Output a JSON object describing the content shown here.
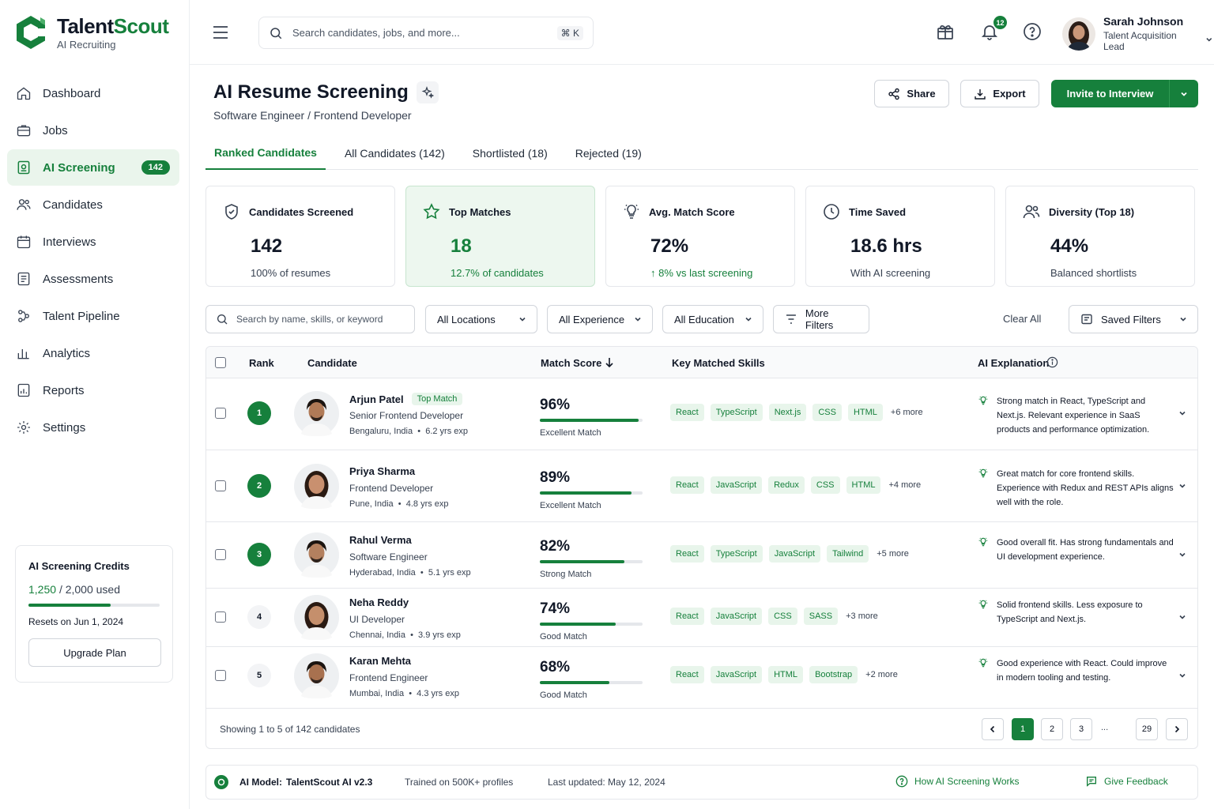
{
  "brand": {
    "name_a": "Talent",
    "name_b": "Scout",
    "sub": "AI Recruiting",
    "accent": "#16803c"
  },
  "nav": [
    {
      "label": "Dashboard",
      "icon": "home-icon"
    },
    {
      "label": "Jobs",
      "icon": "briefcase-icon"
    },
    {
      "label": "AI Screening",
      "icon": "ai-scan-icon",
      "badge": "142",
      "active": true
    },
    {
      "label": "Candidates",
      "icon": "users-icon"
    },
    {
      "label": "Interviews",
      "icon": "calendar-icon"
    },
    {
      "label": "Assessments",
      "icon": "clipboard-icon"
    },
    {
      "label": "Talent Pipeline",
      "icon": "pipeline-icon"
    },
    {
      "label": "Analytics",
      "icon": "bar-chart-icon"
    },
    {
      "label": "Reports",
      "icon": "report-icon"
    },
    {
      "label": "Settings",
      "icon": "gear-icon"
    }
  ],
  "credits": {
    "title": "AI Screening Credits",
    "used": "1,250",
    "total": "/ 2,000 used",
    "fraction": 0.625,
    "reset": "Resets on Jun 1, 2024",
    "upgrade": "Upgrade Plan"
  },
  "topbar": {
    "search_placeholder": "Search candidates, jobs, and more...",
    "shortcut": "⌘ K",
    "notifications": "12"
  },
  "user": {
    "name": "Sarah Johnson",
    "role": "Talent Acquisition Lead"
  },
  "page": {
    "title": "AI Resume Screening",
    "subtitle": "Software Engineer / Frontend Developer",
    "share": "Share",
    "export": "Export",
    "invite": "Invite to Interview"
  },
  "tabs": [
    "Ranked Candidates",
    "All Candidates (142)",
    "Shortlisted (18)",
    "Rejected (19)"
  ],
  "stats": [
    {
      "title": "Candidates Screened",
      "value": "142",
      "sub": "100% of resumes",
      "icon": "shield-icon"
    },
    {
      "title": "Top Matches",
      "value": "18",
      "sub": "12.7% of candidates",
      "icon": "star-icon"
    },
    {
      "title": "Avg. Match Score",
      "value": "72%",
      "sub": "↑ 8% vs last screening",
      "icon": "bulb-icon"
    },
    {
      "title": "Time Saved",
      "value": "18.6 hrs",
      "sub": "With AI screening",
      "icon": "clock-icon"
    },
    {
      "title": "Diversity (Top 18)",
      "value": "44%",
      "sub": "Balanced shortlists",
      "icon": "people-icon"
    }
  ],
  "filters": {
    "search_placeholder": "Search by name, skills, or keyword",
    "locations": "All Locations",
    "experience": "All Experience",
    "education": "All Education",
    "more": "More Filters",
    "clear": "Clear All",
    "saved": "Saved Filters"
  },
  "table": {
    "headers": {
      "rank": "Rank",
      "candidate": "Candidate",
      "score": "Match Score",
      "skills": "Key Matched Skills",
      "explanation": "AI Explanation"
    },
    "rows": [
      {
        "rank": "1",
        "name": "Arjun Patel",
        "badge": "Top Match",
        "title": "Senior Frontend Developer",
        "location": "Bengaluru, India",
        "exp": "6.2 yrs exp",
        "score": "96%",
        "score_value": 0.96,
        "label": "Excellent Match",
        "skills": [
          "React",
          "TypeScript",
          "Next.js",
          "CSS",
          "HTML"
        ],
        "more": "+6 more",
        "explanation": "Strong match in React, TypeScript and Next.js. Relevant experience in SaaS products and performance optimization."
      },
      {
        "rank": "2",
        "name": "Priya Sharma",
        "title": "Frontend Developer",
        "location": "Pune, India",
        "exp": "4.8 yrs exp",
        "score": "89%",
        "score_value": 0.89,
        "label": "Excellent Match",
        "skills": [
          "React",
          "JavaScript",
          "Redux",
          "CSS",
          "HTML"
        ],
        "more": "+4 more",
        "explanation": "Great match for core frontend skills. Experience with Redux and REST APIs aligns well with the role."
      },
      {
        "rank": "3",
        "name": "Rahul Verma",
        "title": "Software Engineer",
        "location": "Hyderabad, India",
        "exp": "5.1 yrs exp",
        "score": "82%",
        "score_value": 0.82,
        "label": "Strong Match",
        "skills": [
          "React",
          "TypeScript",
          "JavaScript",
          "Tailwind"
        ],
        "more": "+5 more",
        "explanation": "Good overall fit. Has strong fundamentals and UI development experience."
      },
      {
        "rank": "4",
        "name": "Neha Reddy",
        "title": "UI Developer",
        "location": "Chennai, India",
        "exp": "3.9 yrs exp",
        "score": "74%",
        "score_value": 0.74,
        "label": "Good Match",
        "skills": [
          "React",
          "JavaScript",
          "CSS",
          "SASS"
        ],
        "more": "+3 more",
        "explanation": "Solid frontend skills. Less exposure to TypeScript and Next.js."
      },
      {
        "rank": "5",
        "name": "Karan Mehta",
        "title": "Frontend Engineer",
        "location": "Mumbai, India",
        "exp": "4.3 yrs exp",
        "score": "68%",
        "score_value": 0.68,
        "label": "Good Match",
        "skills": [
          "React",
          "JavaScript",
          "HTML",
          "Bootstrap"
        ],
        "more": "+2 more",
        "explanation": "Good experience with React. Could improve in modern tooling and testing."
      }
    ],
    "showing": "Showing 1 to 5 of 142 candidates",
    "pages": [
      "1",
      "2",
      "3",
      "...",
      "29"
    ]
  },
  "footer": {
    "model_label": "AI Model:",
    "model": "TalentScout AI v2.3",
    "trained": "Trained on 500K+ profiles",
    "updated": "Last updated: May 12, 2024",
    "how": "How AI Screening Works",
    "feedback": "Give Feedback"
  }
}
